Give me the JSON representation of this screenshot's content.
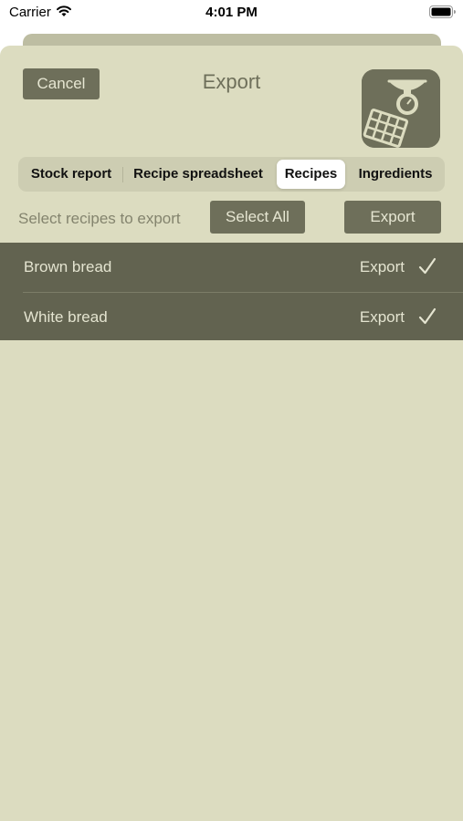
{
  "status_bar": {
    "carrier": "Carrier",
    "time": "4:01 PM",
    "wifi_icon": "wifi-icon",
    "battery_icon": "battery-full-icon"
  },
  "header": {
    "cancel_label": "Cancel",
    "title": "Export",
    "app_icon": "scales-calculator-icon"
  },
  "tabs": [
    {
      "label": "Stock report",
      "selected": false
    },
    {
      "label": "Recipe spreadsheet",
      "selected": false
    },
    {
      "label": "Recipes",
      "selected": true
    },
    {
      "label": "Ingredients",
      "selected": false
    }
  ],
  "toolbar": {
    "prompt": "Select recipes to export",
    "select_all_label": "Select All",
    "export_label": "Export"
  },
  "recipes": [
    {
      "name": "Brown bread",
      "action": "Export",
      "checked": true,
      "check_icon": "checkmark-icon"
    },
    {
      "name": "White bread",
      "action": "Export",
      "checked": true,
      "check_icon": "checkmark-icon"
    }
  ],
  "colors": {
    "sheet_background": "#dcdcc0",
    "accent_dark": "#6e6f5a",
    "list_background": "#626350",
    "segment_background": "#cdcdb2"
  }
}
